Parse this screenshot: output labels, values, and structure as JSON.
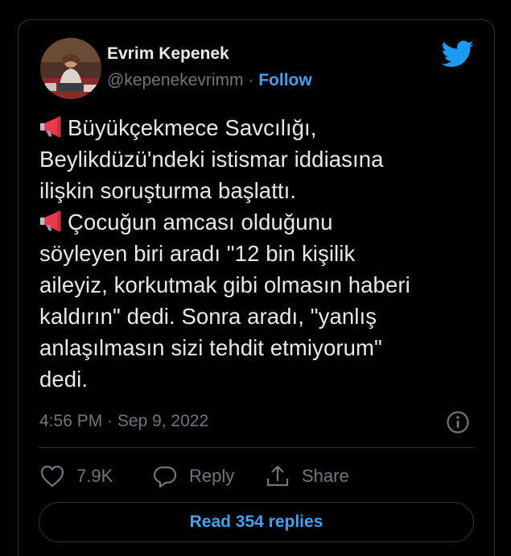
{
  "author": {
    "name": "Evrim Kepenek",
    "handle": "@kepenekevrimm",
    "separator": "·",
    "follow_label": "Follow"
  },
  "tweet": {
    "lines": [
      "Büyükçekmece Savcılığı,",
      "Beylikdüzü'ndeki istismar iddiasına",
      "ilişkin soruşturma başlattı.",
      "Çocuğun amcası olduğunu",
      "söyleyen biri aradı \"12 bin kişilik",
      "aileyiz, korkutmak gibi olmasın haberi",
      "kaldırın\" dedi. Sonra aradı, \"yanlış",
      "anlaşılmasın sizi tehdit etmiyorum\"",
      "dedi."
    ],
    "leading_icons": [
      "megaphone-icon",
      "",
      "",
      "megaphone-icon",
      "",
      "",
      "",
      "",
      ""
    ],
    "timestamp": "4:56 PM · Sep 9, 2022"
  },
  "actions": {
    "like_count": "7.9K",
    "reply_label": "Reply",
    "share_label": "Share"
  },
  "read_replies_label": "Read 354 replies",
  "colors": {
    "background": "#000000",
    "text": "#e7e9ea",
    "muted": "#71767b",
    "accent": "#4a9eea",
    "twitter_blue": "#1d9bf0",
    "border": "#2f3336",
    "megaphone": "#e8394d"
  }
}
